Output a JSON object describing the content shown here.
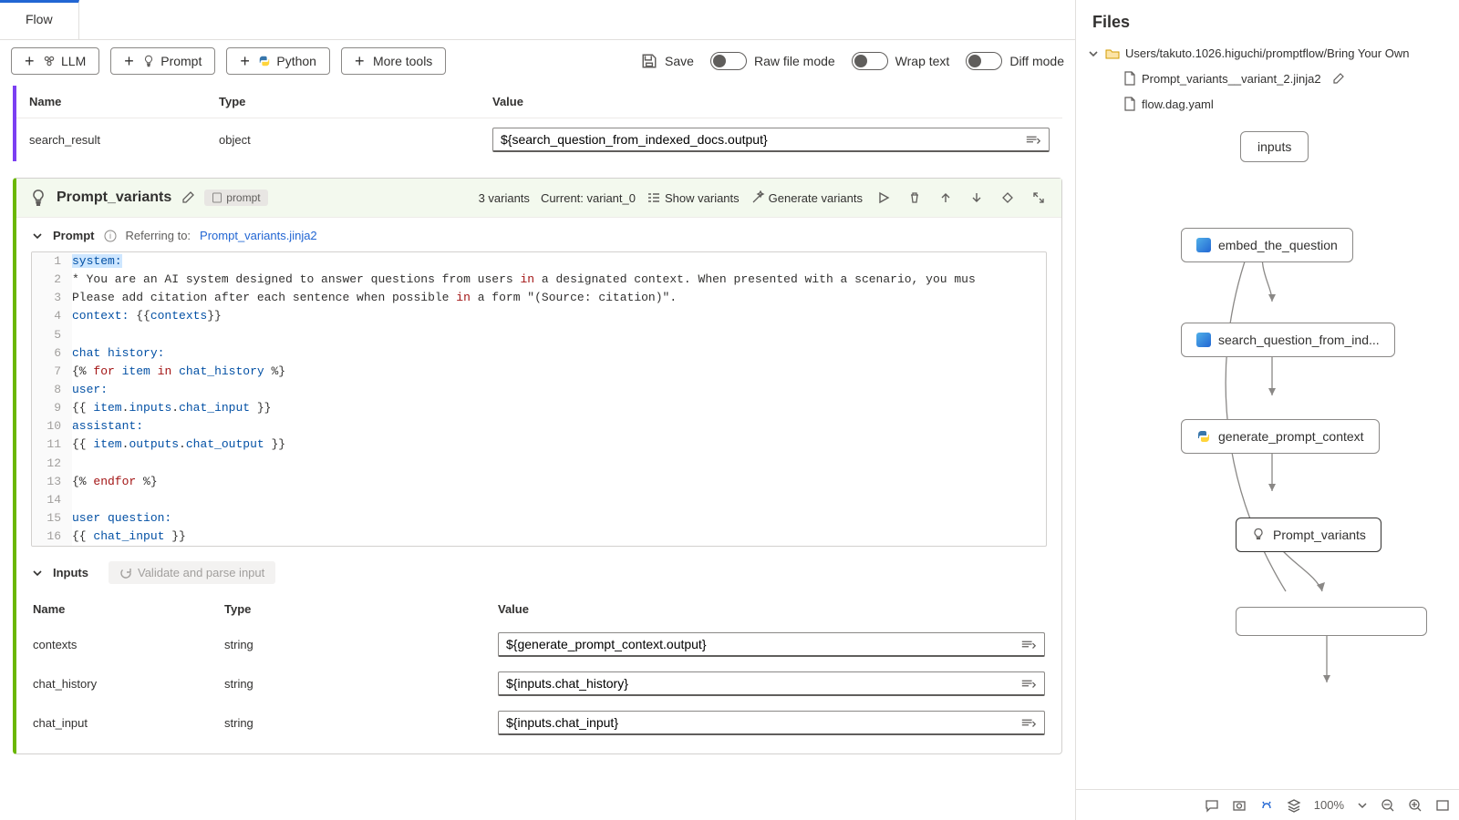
{
  "tab": {
    "label": "Flow"
  },
  "toolbar": {
    "llm": "LLM",
    "prompt": "Prompt",
    "python": "Python",
    "more": "More tools",
    "save": "Save",
    "raw": "Raw file mode",
    "wrap": "Wrap text",
    "diff": "Diff mode"
  },
  "top_inputs": {
    "cols": {
      "name": "Name",
      "type": "Type",
      "value": "Value"
    },
    "rows": [
      {
        "name": "search_result",
        "type": "object",
        "value": "${search_question_from_indexed_docs.output}"
      }
    ]
  },
  "node": {
    "title": "Prompt_variants",
    "badge": "prompt",
    "variant_count": "3 variants",
    "current": "Current: variant_0",
    "show_variants": "Show variants",
    "generate": "Generate variants",
    "prompt_label": "Prompt",
    "referring": "Referring to:",
    "ref_file": "Prompt_variants.jinja2",
    "code": [
      "system:",
      "* You are an AI system designed to answer questions from users in a designated context. When presented with a scenario, you mus",
      "Please add citation after each sentence when possible in a form \"(Source: citation)\".",
      "context: {{contexts}}",
      "",
      "chat history:",
      "{% for item in chat_history %}",
      "user:",
      "{{ item.inputs.chat_input }}",
      "assistant:",
      "{{ item.outputs.chat_output }}",
      "",
      "{% endfor %}",
      "",
      "user question:",
      "{{ chat_input }}"
    ],
    "inputs_label": "Inputs",
    "validate": "Validate and parse input",
    "input_cols": {
      "name": "Name",
      "type": "Type",
      "value": "Value"
    },
    "inputs": [
      {
        "name": "contexts",
        "type": "string",
        "value": "${generate_prompt_context.output}"
      },
      {
        "name": "chat_history",
        "type": "string",
        "value": "${inputs.chat_history}"
      },
      {
        "name": "chat_input",
        "type": "string",
        "value": "${inputs.chat_input}"
      }
    ]
  },
  "files": {
    "title": "Files",
    "folder": "Users/takuto.1026.higuchi/promptflow/Bring Your Own",
    "items": [
      {
        "name": "Prompt_variants__variant_2.jinja2",
        "editable": true
      },
      {
        "name": "flow.dag.yaml",
        "editable": false
      }
    ]
  },
  "graph": {
    "nodes": {
      "inputs": "inputs",
      "embed": "embed_the_question",
      "search": "search_question_from_ind...",
      "genctx": "generate_prompt_context",
      "pv": "Prompt_variants"
    }
  },
  "bottom": {
    "zoom": "100%"
  }
}
